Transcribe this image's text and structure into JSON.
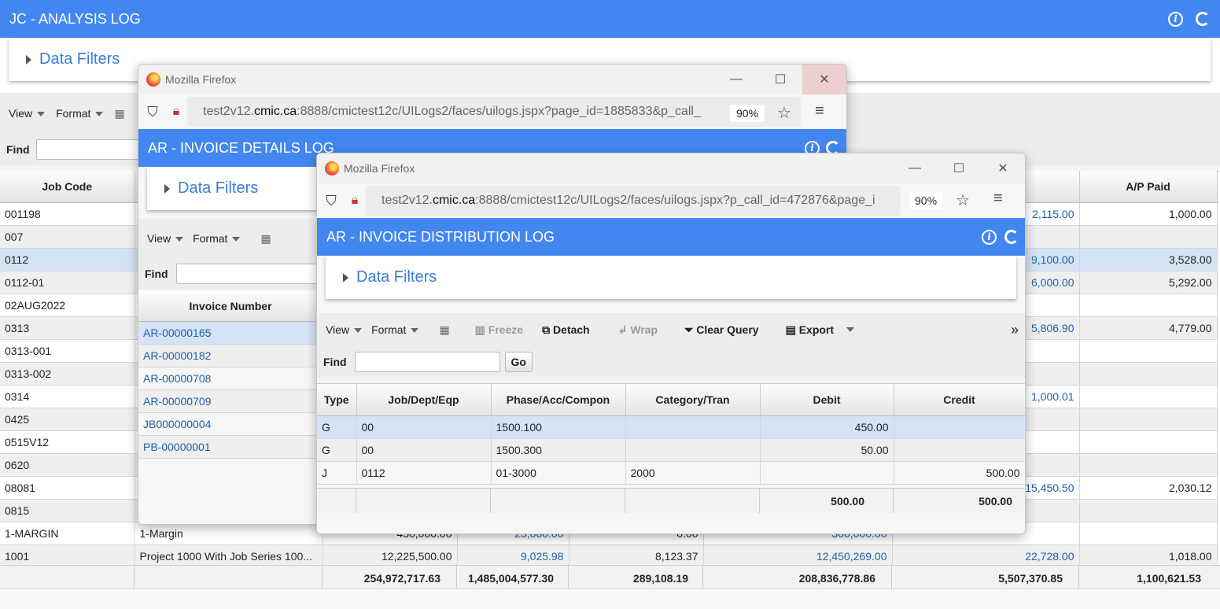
{
  "main": {
    "title": "JC - ANALYSIS LOG",
    "filters_label": "Data Filters",
    "view_label": "View",
    "format_label": "Format",
    "find_label": "Find",
    "columns": [
      "Job Code",
      "",
      "",
      "",
      "",
      "",
      "",
      "A/P Paid"
    ],
    "rows": [
      {
        "job": "001198",
        "desc": "",
        "c2": "",
        "c3": "",
        "c4": "",
        "c5": "",
        "c6": "2,115.00",
        "paid": "1,000.00"
      },
      {
        "job": "007",
        "desc": "",
        "c2": "",
        "c3": "",
        "c4": "",
        "c5": "",
        "c6": "",
        "paid": ""
      },
      {
        "job": "0112",
        "desc": "",
        "c2": "",
        "c3": "",
        "c4": "",
        "c5": "",
        "c6": "9,100.00",
        "paid": "3,528.00"
      },
      {
        "job": "0112-01",
        "desc": "",
        "c2": "",
        "c3": "",
        "c4": "",
        "c5": "",
        "c6": "6,000.00",
        "paid": "5,292.00"
      },
      {
        "job": "02AUG2022",
        "desc": "",
        "c2": "",
        "c3": "",
        "c4": "",
        "c5": "",
        "c6": "",
        "paid": ""
      },
      {
        "job": "0313",
        "desc": "",
        "c2": "",
        "c3": "",
        "c4": "",
        "c5": "",
        "c6": "5,806.90",
        "paid": "4,779.00"
      },
      {
        "job": "0313-001",
        "desc": "",
        "c2": "",
        "c3": "",
        "c4": "",
        "c5": "",
        "c6": "",
        "paid": ""
      },
      {
        "job": "0313-002",
        "desc": "",
        "c2": "",
        "c3": "",
        "c4": "",
        "c5": "",
        "c6": "",
        "paid": ""
      },
      {
        "job": "0314",
        "desc": "",
        "c2": "",
        "c3": "",
        "c4": "",
        "c5": "",
        "c6": "1,000.01",
        "paid": ""
      },
      {
        "job": "0425",
        "desc": "",
        "c2": "",
        "c3": "",
        "c4": "",
        "c5": "",
        "c6": "",
        "paid": ""
      },
      {
        "job": "0515V12",
        "desc": "",
        "c2": "",
        "c3": "",
        "c4": "",
        "c5": "",
        "c6": "",
        "paid": ""
      },
      {
        "job": "0620",
        "desc": "",
        "c2": "",
        "c3": "",
        "c4": "",
        "c5": "",
        "c6": "",
        "paid": ""
      },
      {
        "job": "08081",
        "desc": "",
        "c2": "",
        "c3": "",
        "c4": "",
        "c5": "",
        "c6": "15,450.50",
        "paid": "2,030.12"
      },
      {
        "job": "0815",
        "desc": "",
        "c2": "",
        "c3": "",
        "c4": "",
        "c5": "",
        "c6": "",
        "paid": ""
      },
      {
        "job": "1-MARGIN",
        "desc": "1-Margin",
        "c2": "450,000.00",
        "c3": "23,000.00",
        "c4": "0.00",
        "c5": "300,000.00",
        "c6": "",
        "paid": ""
      },
      {
        "job": "1001",
        "desc": "Project 1000 With Job Series 100...",
        "c2": "12,225,500.00",
        "c3": "9,025.98",
        "c4": "8,123.37",
        "c5": "12,450,269.00",
        "c6": "22,728.00",
        "paid": "1,018.00"
      }
    ],
    "totals": [
      "",
      "",
      "254,972,717.63",
      "1,485,004,577.30",
      "289,108.19",
      "208,836,778.86",
      "5,507,370.85",
      "1,100,621.53"
    ]
  },
  "win1": {
    "browser": "Mozilla Firefox",
    "url_prefix": "test2v12.",
    "url_domain": "cmic.ca",
    "url_rest": ":8888/cmictest12c/UILogs2/faces/uilogs.jspx?page_id=1885833&p_call_",
    "zoom": "90%",
    "title": "AR - INVOICE DETAILS LOG",
    "filters_label": "Data Filters",
    "view_label": "View",
    "format_label": "Format",
    "find_label": "Find",
    "column": "Invoice Number",
    "invoices": [
      "AR-00000165",
      "AR-00000182",
      "AR-00000708",
      "AR-00000709",
      "JB000000004",
      "PB-00000001"
    ]
  },
  "win2": {
    "browser": "Mozilla Firefox",
    "url_prefix": "test2v12.",
    "url_domain": "cmic.ca",
    "url_rest": ":8888/cmictest12c/UILogs2/faces/uilogs.jspx?p_call_id=472876&page_i",
    "zoom": "90%",
    "title": "AR - INVOICE DISTRIBUTION LOG",
    "filters_label": "Data Filters",
    "toolbar": {
      "view": "View",
      "format": "Format",
      "freeze": "Freeze",
      "detach": "Detach",
      "wrap": "Wrap",
      "clear_query": "Clear Query",
      "export": "Export"
    },
    "find_label": "Find",
    "go_label": "Go",
    "columns": [
      "Type",
      "Job/Dept/Eqp",
      "Phase/Acc/Compon",
      "Category/Tran",
      "Debit",
      "Credit"
    ],
    "rows": [
      {
        "type": "G",
        "job": "00",
        "phase": "1500.100",
        "cat": "",
        "debit": "450.00",
        "credit": ""
      },
      {
        "type": "G",
        "job": "00",
        "phase": "1500.300",
        "cat": "",
        "debit": "50.00",
        "credit": ""
      },
      {
        "type": "J",
        "job": "0112",
        "phase": "01-3000",
        "cat": "2000",
        "debit": "",
        "credit": "500.00"
      }
    ],
    "total_debit": "500.00",
    "total_credit": "500.00"
  },
  "colors": {
    "header_blue": "#4287f0",
    "link_blue": "#1e5fa8",
    "selected_row": "#d5e3f7"
  }
}
